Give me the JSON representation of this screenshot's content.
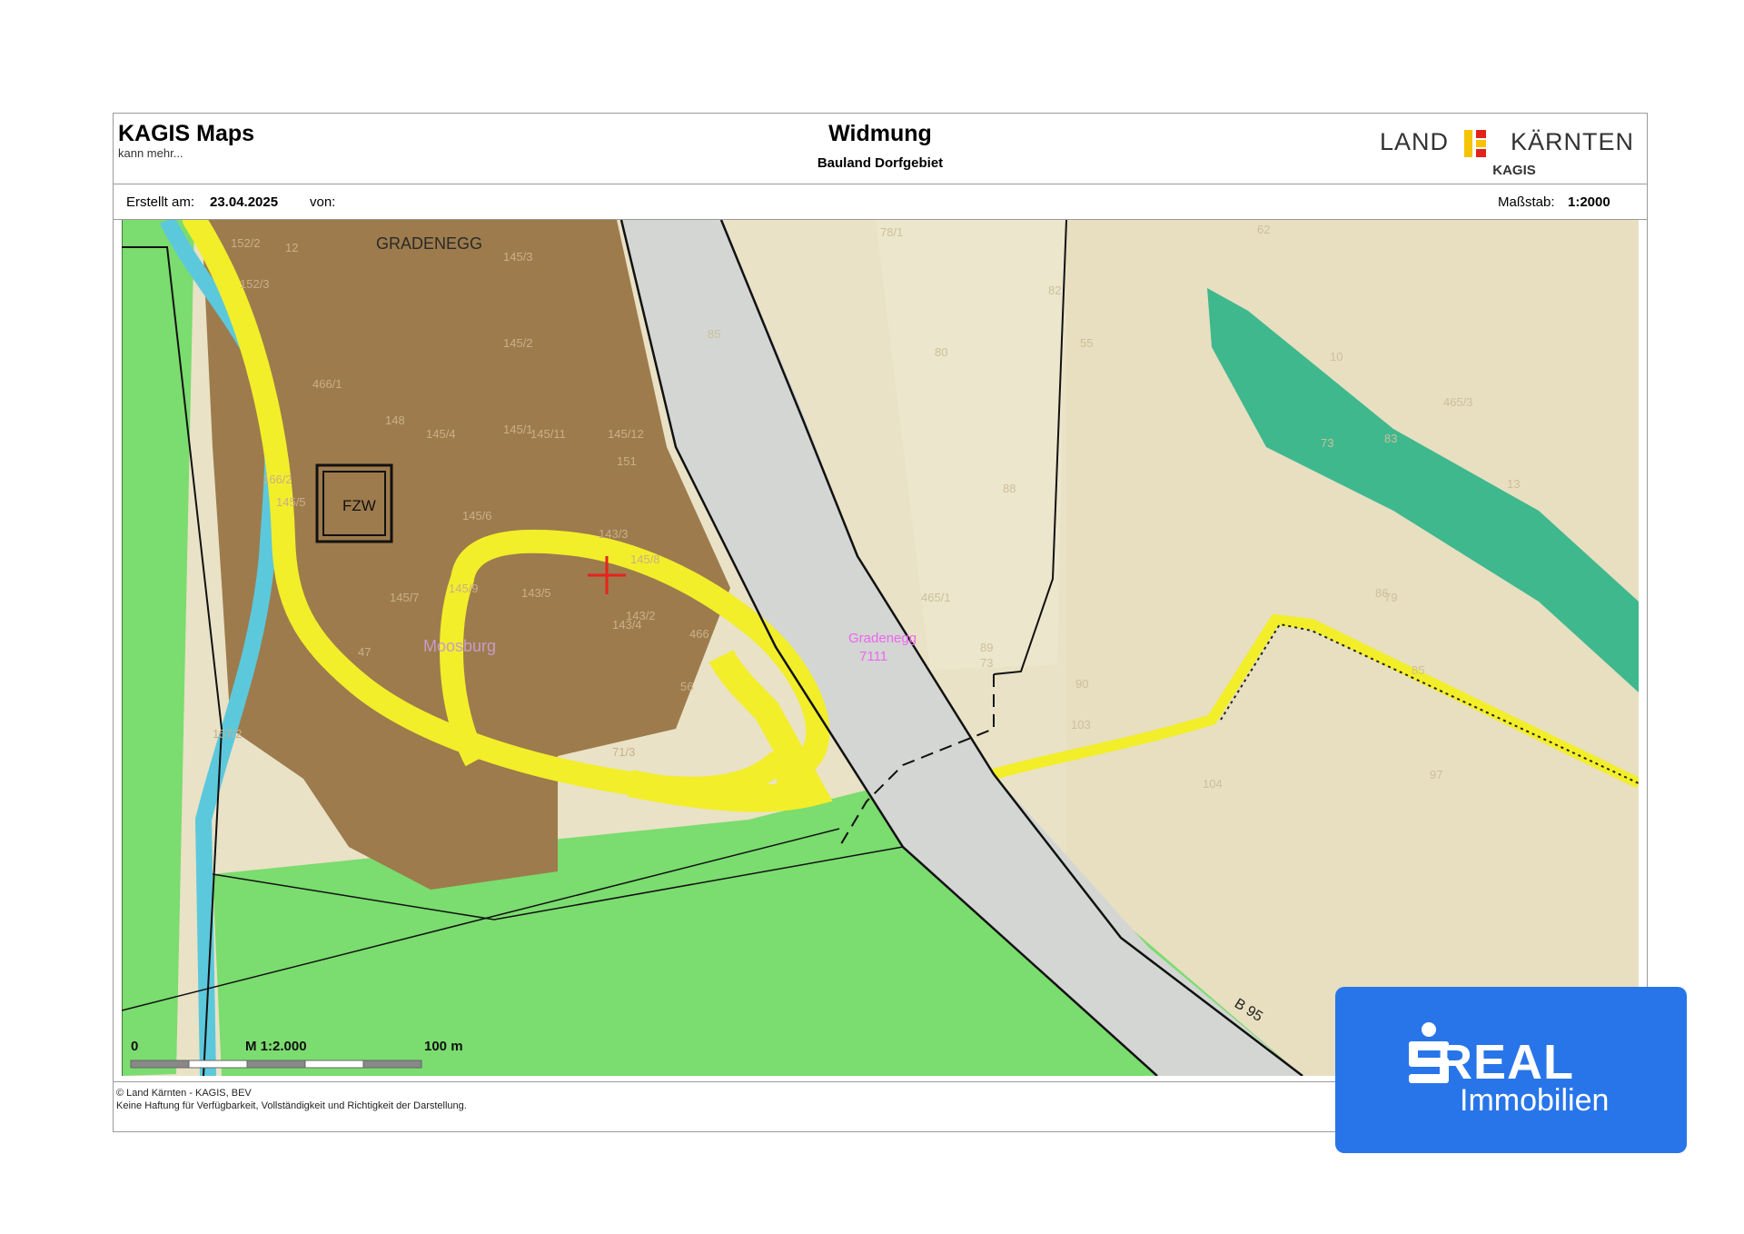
{
  "header": {
    "brand_title": "KAGIS Maps",
    "brand_subtitle": "kann mehr...",
    "map_title": "Widmung",
    "map_subtitle": "Bauland Dorfgebiet",
    "logo_left": "LAND",
    "logo_right": "KÄRNTEN",
    "logo_sub": "KAGIS"
  },
  "meta": {
    "created_label": "Erstellt am:",
    "created_date": "23.04.2025",
    "by_label": "von:",
    "scale_label": "Maßstab:",
    "scale_value": "1:2000"
  },
  "map": {
    "place_labels": [
      "GRADENEGG",
      "Moosburg",
      "Gradenegg",
      "7111"
    ],
    "road_label": "B 95",
    "fzw_label": "FZW",
    "parcels": [
      "152/2",
      "12",
      "152/3",
      "145/3",
      "145/2",
      "145/1",
      "466/1",
      "148",
      "145/4",
      "145/11",
      "145/12",
      "151",
      "166/2",
      "145/5",
      "145/6",
      "145/9",
      "143/3",
      "145/8",
      "143/2",
      "145/7",
      "143/5",
      "143/4",
      "466",
      "56",
      "47",
      "157/2",
      "71/3",
      "78/1",
      "85",
      "62",
      "82",
      "80",
      "73",
      "55",
      "10",
      "83",
      "88",
      "86",
      "79",
      "465/3",
      "465/1",
      "89",
      "73",
      "90",
      "103",
      "85",
      "104",
      "97",
      "13"
    ],
    "scalebar": {
      "start": "0",
      "middle": "M 1:2.000",
      "end": "100 m"
    }
  },
  "footer": {
    "copyright": "© Land Kärnten - KAGIS, BEV",
    "disclaimer": "Keine Haftung für Verfügbarkeit, Vollständigkeit und Richtigkeit der Darstellung."
  },
  "watermark": {
    "name": "REAL",
    "subtitle": "Immobilien",
    "icon": "sparkasse-s-icon",
    "color": "#2875ea"
  },
  "colors": {
    "bauland": "#9d7b4c",
    "gruenland": "#7bdc6f",
    "verkehr": "#f2ee2a",
    "gewaesser": "#5cc8dc",
    "strasse": "#d6d9d6",
    "acker": "#ece3c6",
    "wald": "#3fb88e",
    "marker": "#e8221e"
  }
}
